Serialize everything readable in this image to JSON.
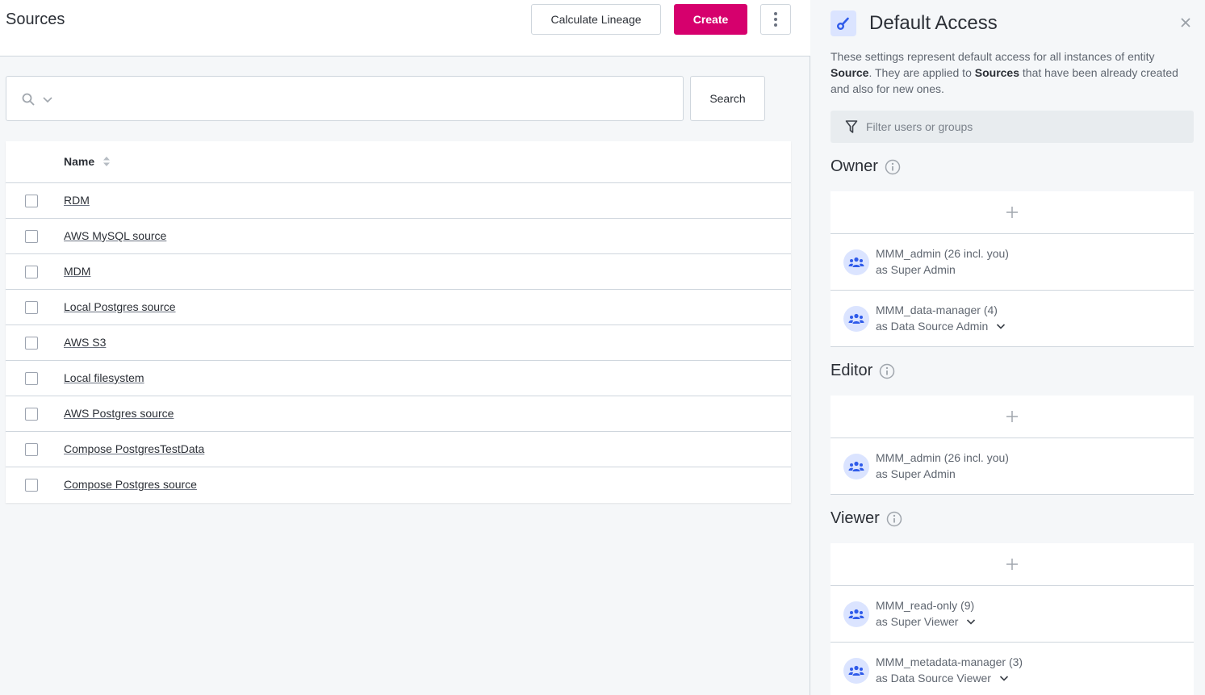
{
  "header": {
    "title": "Sources",
    "calculate_lineage_label": "Calculate Lineage",
    "create_label": "Create",
    "create_color": "#d6006d"
  },
  "search": {
    "value": "",
    "placeholder": "",
    "button_label": "Search"
  },
  "table": {
    "columns": [
      {
        "label": "Name",
        "sortable": true
      }
    ],
    "rows": [
      {
        "name": "RDM",
        "checked": false
      },
      {
        "name": "AWS MySQL source",
        "checked": false
      },
      {
        "name": "MDM",
        "checked": false
      },
      {
        "name": "Local Postgres source",
        "checked": false
      },
      {
        "name": "AWS S3",
        "checked": false
      },
      {
        "name": "Local filesystem",
        "checked": false
      },
      {
        "name": "AWS Postgres source",
        "checked": false
      },
      {
        "name": "Compose PostgresTestData",
        "checked": false
      },
      {
        "name": "Compose Postgres source",
        "checked": false
      }
    ]
  },
  "panel": {
    "icon": "key-icon",
    "title": "Default Access",
    "desc_part1": "These settings represent default access for all instances of entity ",
    "desc_bold1": "Source",
    "desc_part2": ". They are applied to ",
    "desc_bold2": "Sources",
    "desc_part3": " that have been already created and also for new ones.",
    "filter_placeholder": "Filter users or groups",
    "filter_value": "",
    "accent_color": "#2f5bea",
    "sections": [
      {
        "title": "Owner",
        "members": [
          {
            "name": "MMM_admin (26 incl. you)",
            "role": "as Super Admin",
            "has_dropdown": false
          },
          {
            "name": "MMM_data-manager (4)",
            "role": "as Data Source Admin",
            "has_dropdown": true
          }
        ]
      },
      {
        "title": "Editor",
        "members": [
          {
            "name": "MMM_admin (26 incl. you)",
            "role": "as Super Admin",
            "has_dropdown": false
          }
        ]
      },
      {
        "title": "Viewer",
        "members": [
          {
            "name": "MMM_read-only (9)",
            "role": "as Super Viewer",
            "has_dropdown": true
          },
          {
            "name": "MMM_metadata-manager (3)",
            "role": "as Data Source Viewer",
            "has_dropdown": true
          }
        ]
      }
    ]
  }
}
